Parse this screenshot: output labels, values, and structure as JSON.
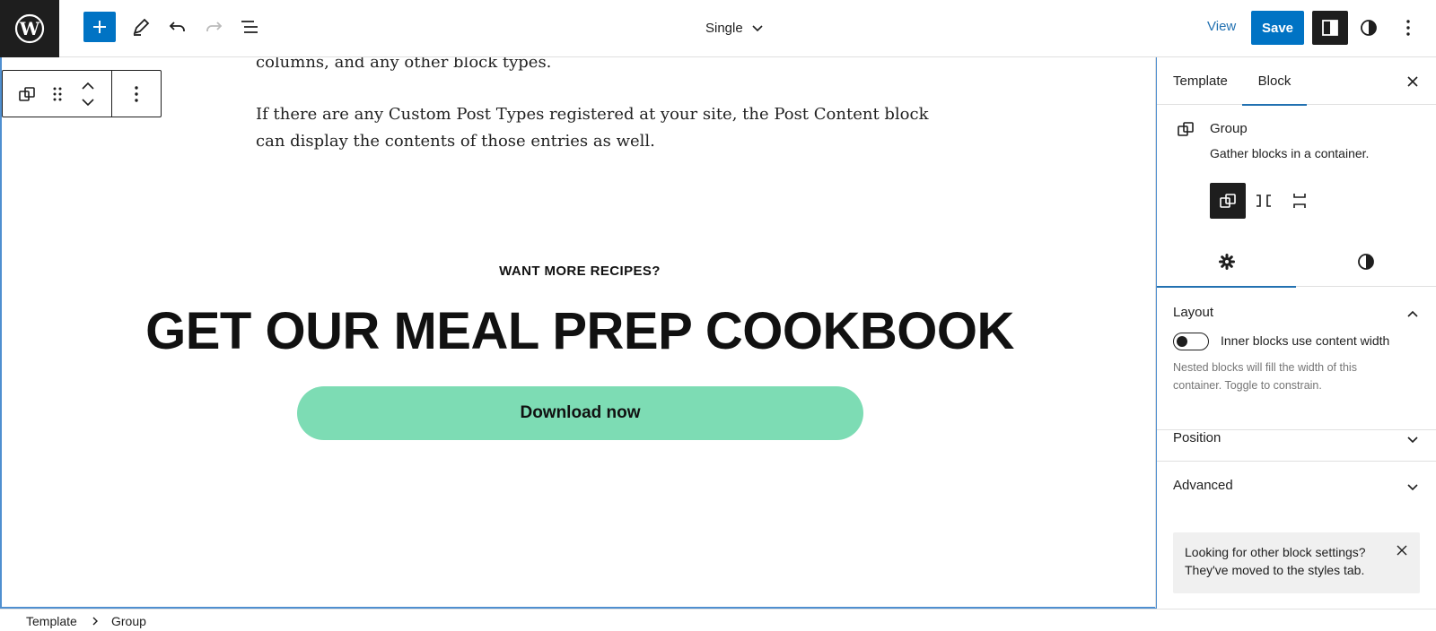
{
  "header": {
    "logo_icon": "wordpress-logo-icon",
    "add_block_icon": "plus-icon",
    "tools_icon": "pencil-icon",
    "undo_icon": "undo-icon",
    "redo_icon": "redo-icon",
    "list_view_icon": "list-view-icon",
    "document_title": "Single",
    "view_label": "View",
    "save_label": "Save",
    "settings_icon": "sidebar-toggle-icon",
    "styles_icon": "half-circle-icon",
    "options_icon": "more-vertical-icon"
  },
  "canvas": {
    "paragraph_fragment": "columns, and any other block types.",
    "paragraph_2_line_1": "If there are any Custom Post Types registered at your site, the Post Content block",
    "paragraph_2_line_2": "can display the contents of those entries as well.",
    "eyebrow": "WANT MORE RECIPES?",
    "headline": "GET OUR MEAL PREP COOKBOOK",
    "button_label": "Download now",
    "button_color": "#7ddcb4"
  },
  "block_toolbar": {
    "block_icon": "group-icon",
    "drag_icon": "drag-handle-icon",
    "move_up_icon": "chevron-up-icon",
    "move_down_icon": "chevron-down-icon",
    "options_icon": "more-vertical-icon"
  },
  "sidebar": {
    "tabs": [
      {
        "label": "Template",
        "active": false
      },
      {
        "label": "Block",
        "active": true
      }
    ],
    "block": {
      "name": "Group",
      "description": "Gather blocks in a container."
    },
    "variations": [
      "group",
      "row",
      "stack"
    ],
    "sub_tabs": [
      "settings",
      "styles"
    ],
    "panels": {
      "layout": {
        "title": "Layout",
        "toggle_label": "Inner blocks use content width",
        "toggle_on": false,
        "help_line_1": "Nested blocks will fill the width of this",
        "help_line_2": "container. Toggle to constrain."
      },
      "position": {
        "title": "Position"
      },
      "advanced": {
        "title": "Advanced"
      }
    },
    "notice": {
      "line_1": "Looking for other block settings?",
      "line_2": "They've moved to the styles tab."
    }
  },
  "footer": {
    "breadcrumbs": [
      "Template",
      "Group"
    ]
  },
  "colors": {
    "accent": "#0073c4",
    "link": "#2271b1",
    "dark": "#1e1e1e"
  }
}
